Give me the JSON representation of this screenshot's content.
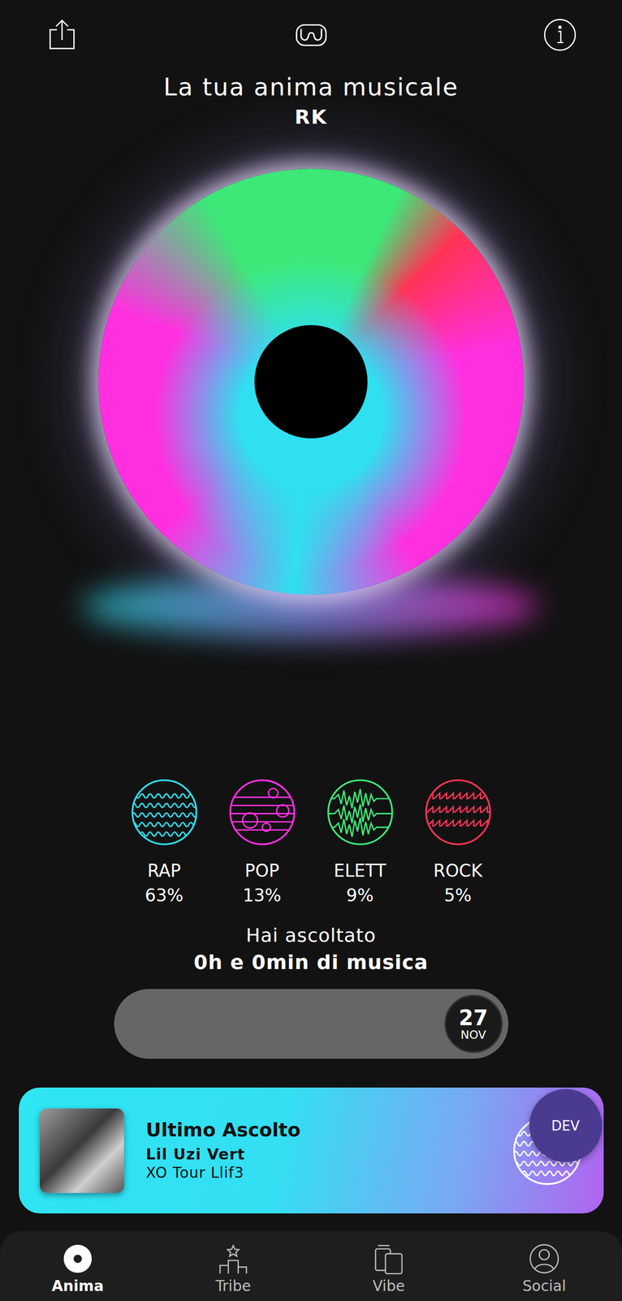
{
  "header": {
    "title": "La tua anima musicale",
    "user": "RK"
  },
  "genres": [
    {
      "name": "RAP",
      "percent": "63%",
      "color": "#2fe0f0"
    },
    {
      "name": "POP",
      "percent": "13%",
      "color": "#ff2fe0"
    },
    {
      "name": "ELETT",
      "percent": "9%",
      "color": "#3de878"
    },
    {
      "name": "ROCK",
      "percent": "5%",
      "color": "#ff3355"
    }
  ],
  "listening": {
    "label": "Hai ascoltato",
    "amount": "0h e 0min di musica"
  },
  "date_slider": {
    "day": "27",
    "month": "NOV",
    "level": 1
  },
  "last_listen": {
    "label": "Ultimo Ascolto",
    "artist": "Lil Uzi Vert",
    "track": "XO Tour Llif3"
  },
  "dev_badge": "DEV",
  "nav": [
    {
      "label": "Anima",
      "selected": true
    },
    {
      "label": "Tribe",
      "selected": false
    },
    {
      "label": "Vibe",
      "selected": false
    },
    {
      "label": "Social",
      "selected": false
    }
  ]
}
